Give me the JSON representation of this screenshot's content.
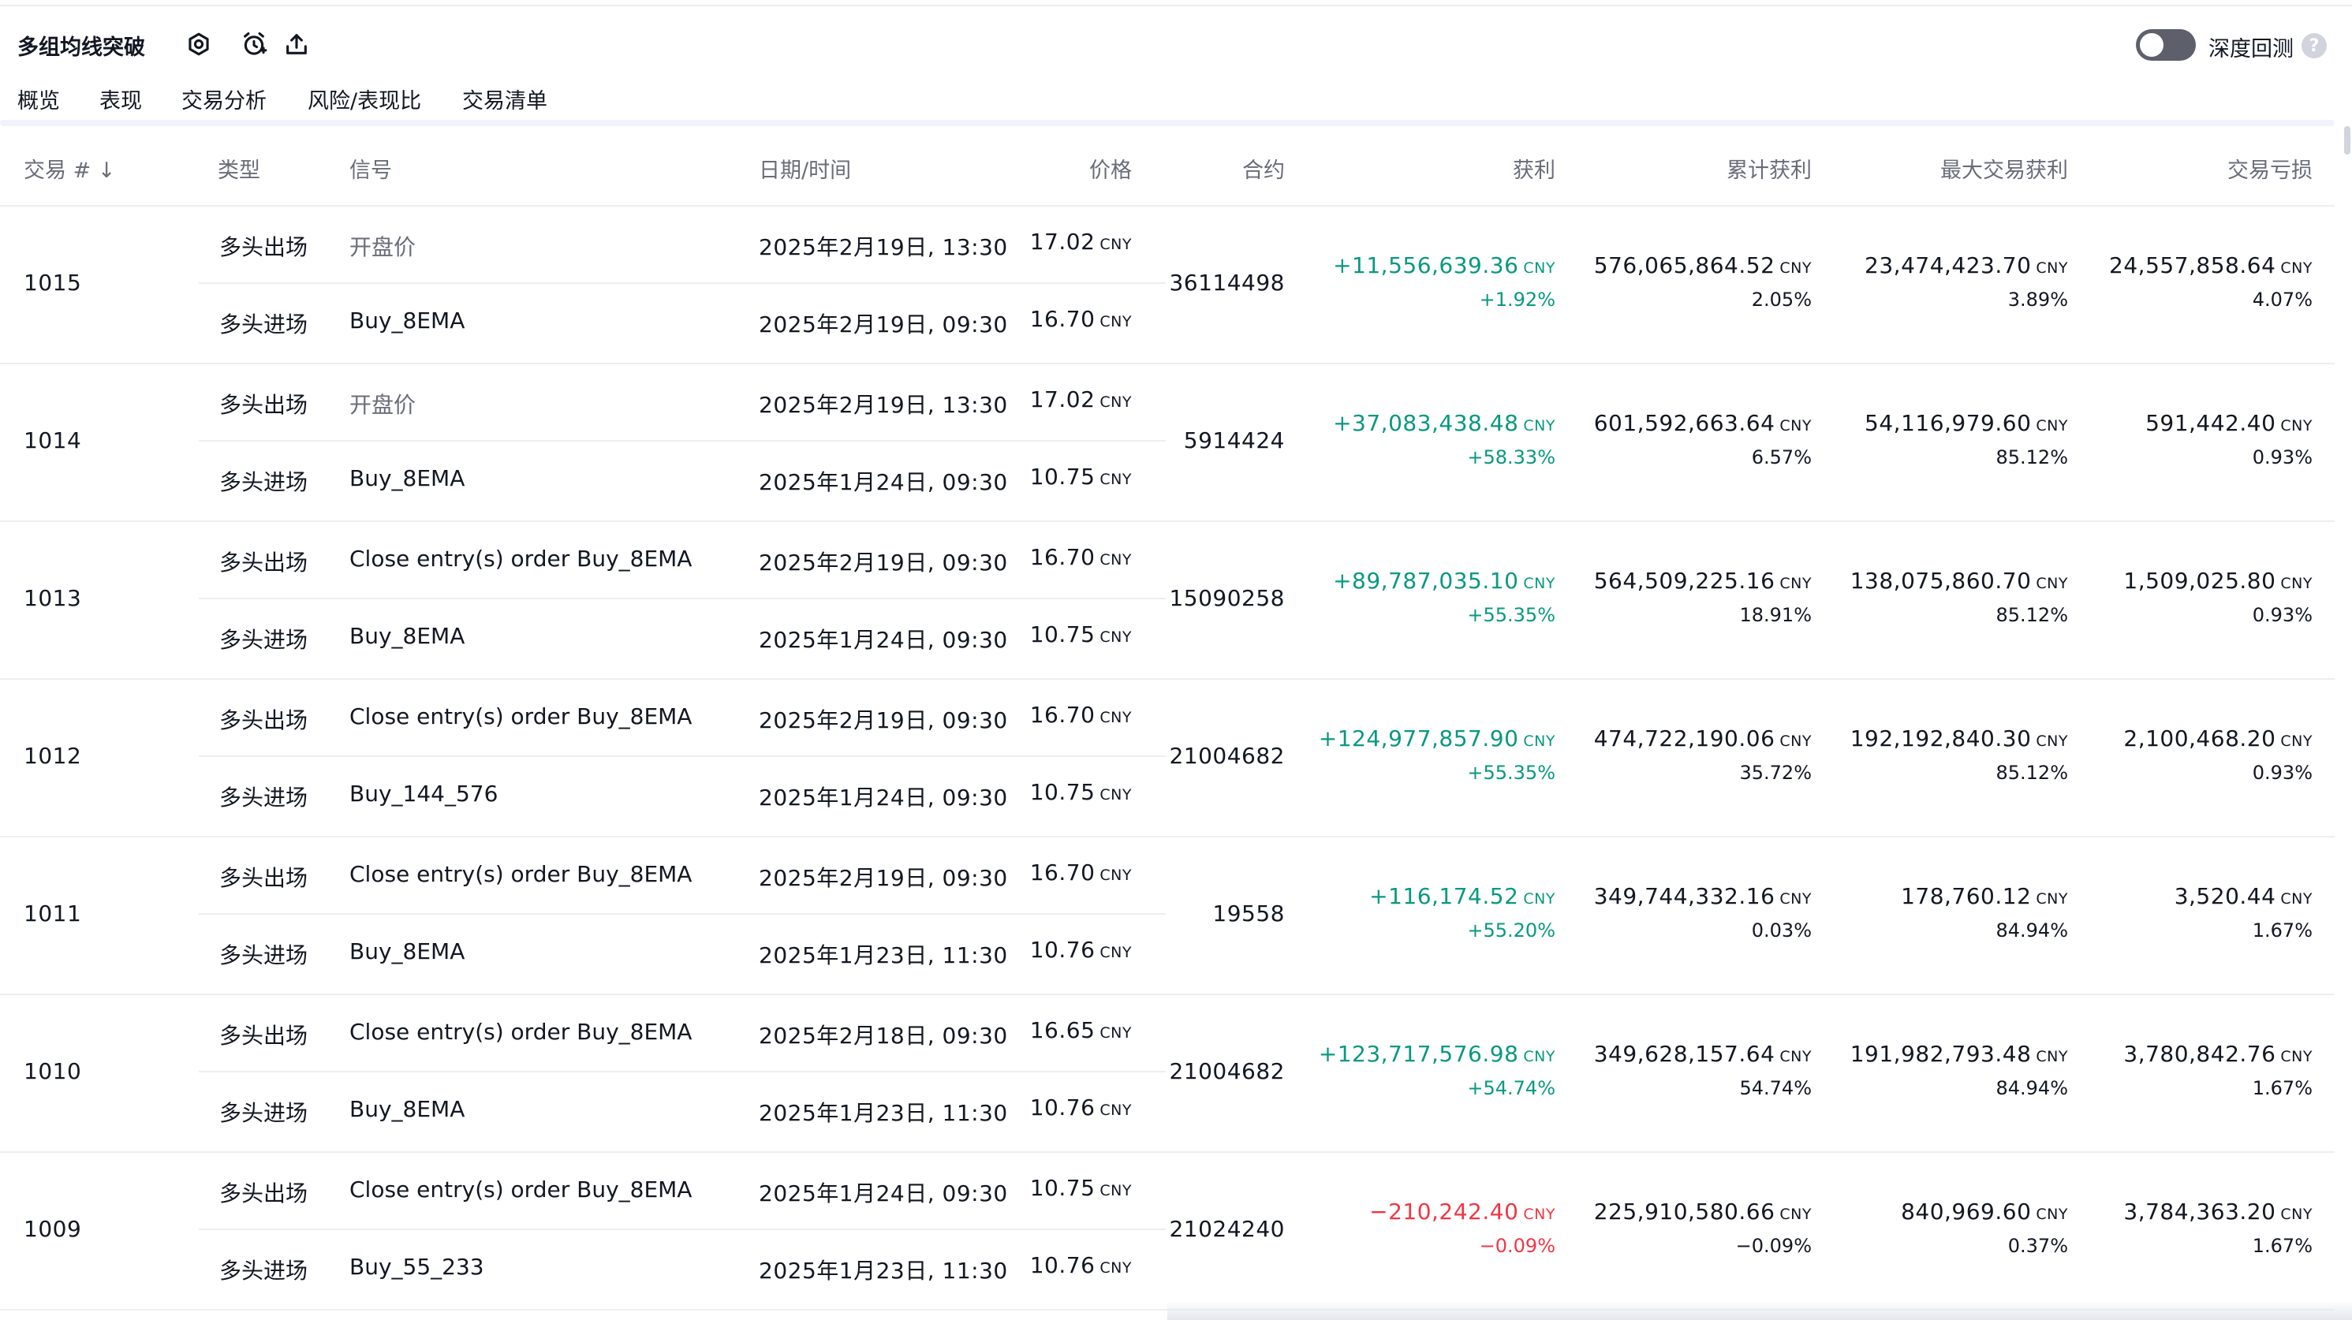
{
  "header": {
    "title": "多组均线突破",
    "settings_icon": "gear-icon",
    "alert_icon": "add-alarm-icon",
    "share_icon": "upload-icon",
    "deep_backtest_label": "深度回测",
    "help_label": "?"
  },
  "tabs": [
    {
      "label": "概览",
      "active": false
    },
    {
      "label": "表现",
      "active": false
    },
    {
      "label": "交易分析",
      "active": false
    },
    {
      "label": "风险/表现比",
      "active": false
    },
    {
      "label": "交易清单",
      "active": true
    }
  ],
  "table": {
    "columns": {
      "trade_no": "交易 # ↓",
      "type": "类型",
      "signal": "信号",
      "datetime": "日期/时间",
      "price": "价格",
      "contracts": "合约",
      "profit": "获利",
      "cum_profit": "累计获利",
      "run_up": "最大交易获利",
      "drawdown": "交易亏损"
    },
    "unit": "CNY",
    "trades": [
      {
        "no": "1015",
        "exit": {
          "type": "多头出场",
          "signal": "开盘价",
          "datetime": "2025年2月19日, 13:30",
          "price": "17.02"
        },
        "entry": {
          "type": "多头进场",
          "signal": "Buy_8EMA",
          "datetime": "2025年2月19日, 09:30",
          "price": "16.70"
        },
        "contracts": "36114498",
        "profit": "+11,556,639.36",
        "profit_pct": "+1.92%",
        "profit_sign": "pos",
        "cum_profit": "576,065,864.52",
        "cum_pct": "2.05%",
        "run_up": "23,474,423.70",
        "run_up_pct": "3.89%",
        "drawdown": "24,557,858.64",
        "drawdown_pct": "4.07%"
      },
      {
        "no": "1014",
        "exit": {
          "type": "多头出场",
          "signal": "开盘价",
          "datetime": "2025年2月19日, 13:30",
          "price": "17.02"
        },
        "entry": {
          "type": "多头进场",
          "signal": "Buy_8EMA",
          "datetime": "2025年1月24日, 09:30",
          "price": "10.75"
        },
        "contracts": "5914424",
        "profit": "+37,083,438.48",
        "profit_pct": "+58.33%",
        "profit_sign": "pos",
        "cum_profit": "601,592,663.64",
        "cum_pct": "6.57%",
        "run_up": "54,116,979.60",
        "run_up_pct": "85.12%",
        "drawdown": "591,442.40",
        "drawdown_pct": "0.93%"
      },
      {
        "no": "1013",
        "exit": {
          "type": "多头出场",
          "signal": "Close entry(s) order Buy_8EMA",
          "datetime": "2025年2月19日, 09:30",
          "price": "16.70"
        },
        "entry": {
          "type": "多头进场",
          "signal": "Buy_8EMA",
          "datetime": "2025年1月24日, 09:30",
          "price": "10.75"
        },
        "contracts": "15090258",
        "profit": "+89,787,035.10",
        "profit_pct": "+55.35%",
        "profit_sign": "pos",
        "cum_profit": "564,509,225.16",
        "cum_pct": "18.91%",
        "run_up": "138,075,860.70",
        "run_up_pct": "85.12%",
        "drawdown": "1,509,025.80",
        "drawdown_pct": "0.93%"
      },
      {
        "no": "1012",
        "exit": {
          "type": "多头出场",
          "signal": "Close entry(s) order Buy_8EMA",
          "datetime": "2025年2月19日, 09:30",
          "price": "16.70"
        },
        "entry": {
          "type": "多头进场",
          "signal": "Buy_144_576",
          "datetime": "2025年1月24日, 09:30",
          "price": "10.75"
        },
        "contracts": "21004682",
        "profit": "+124,977,857.90",
        "profit_pct": "+55.35%",
        "profit_sign": "pos",
        "cum_profit": "474,722,190.06",
        "cum_pct": "35.72%",
        "run_up": "192,192,840.30",
        "run_up_pct": "85.12%",
        "drawdown": "2,100,468.20",
        "drawdown_pct": "0.93%"
      },
      {
        "no": "1011",
        "exit": {
          "type": "多头出场",
          "signal": "Close entry(s) order Buy_8EMA",
          "datetime": "2025年2月19日, 09:30",
          "price": "16.70"
        },
        "entry": {
          "type": "多头进场",
          "signal": "Buy_8EMA",
          "datetime": "2025年1月23日, 11:30",
          "price": "10.76"
        },
        "contracts": "19558",
        "profit": "+116,174.52",
        "profit_pct": "+55.20%",
        "profit_sign": "pos",
        "cum_profit": "349,744,332.16",
        "cum_pct": "0.03%",
        "run_up": "178,760.12",
        "run_up_pct": "84.94%",
        "drawdown": "3,520.44",
        "drawdown_pct": "1.67%"
      },
      {
        "no": "1010",
        "exit": {
          "type": "多头出场",
          "signal": "Close entry(s) order Buy_8EMA",
          "datetime": "2025年2月18日, 09:30",
          "price": "16.65"
        },
        "entry": {
          "type": "多头进场",
          "signal": "Buy_8EMA",
          "datetime": "2025年1月23日, 11:30",
          "price": "10.76"
        },
        "contracts": "21004682",
        "profit": "+123,717,576.98",
        "profit_pct": "+54.74%",
        "profit_sign": "pos",
        "cum_profit": "349,628,157.64",
        "cum_pct": "54.74%",
        "run_up": "191,982,793.48",
        "run_up_pct": "84.94%",
        "drawdown": "3,780,842.76",
        "drawdown_pct": "1.67%"
      },
      {
        "no": "1009",
        "exit": {
          "type": "多头出场",
          "signal": "Close entry(s) order Buy_8EMA",
          "datetime": "2025年1月24日, 09:30",
          "price": "10.75"
        },
        "entry": {
          "type": "多头进场",
          "signal": "Buy_55_233",
          "datetime": "2025年1月23日, 11:30",
          "price": "10.76"
        },
        "contracts": "21024240",
        "profit": "−210,242.40",
        "profit_pct": "−0.09%",
        "profit_sign": "neg",
        "cum_profit": "225,910,580.66",
        "cum_pct": "−0.09%",
        "run_up": "840,969.60",
        "run_up_pct": "0.37%",
        "drawdown": "3,784,363.20",
        "drawdown_pct": "1.67%"
      }
    ]
  },
  "colors": {
    "positive": "#089981",
    "negative": "#f23645",
    "muted": "#6a6d78",
    "text": "#131722"
  }
}
